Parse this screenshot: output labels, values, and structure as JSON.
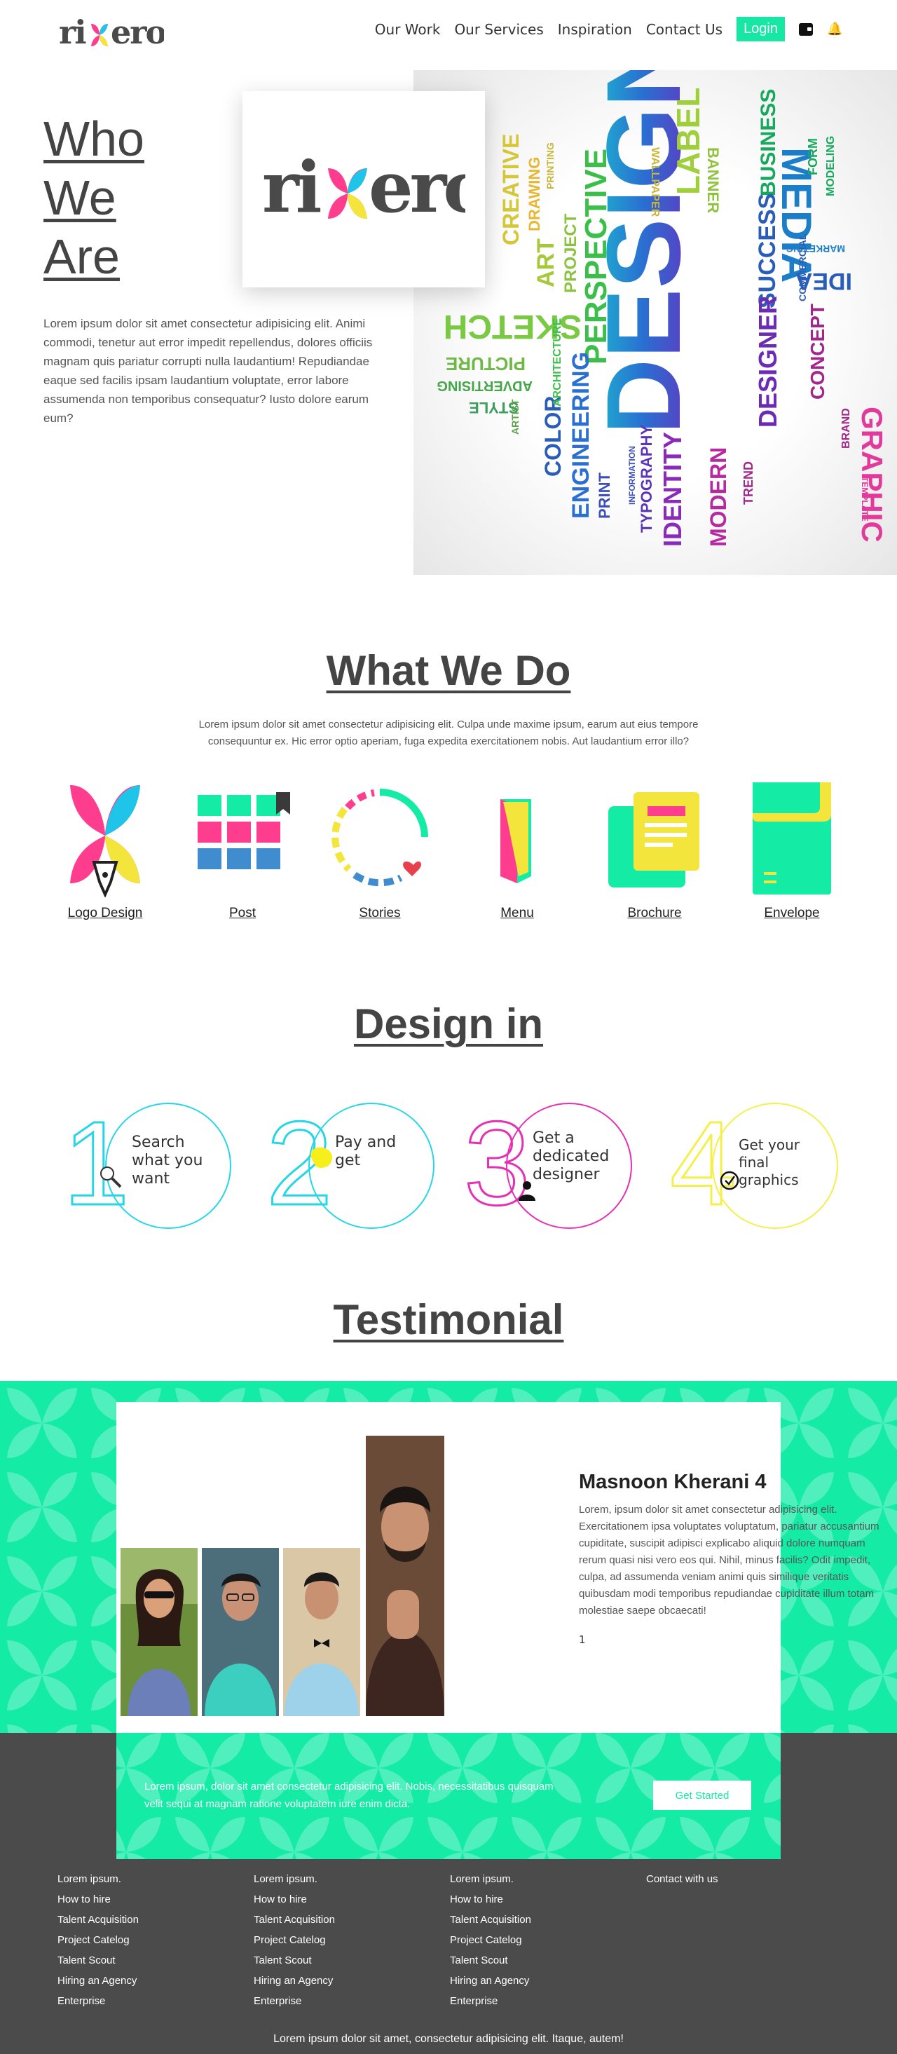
{
  "brand": {
    "logo_text": "rixero",
    "accent": "#16e8a4",
    "dark": "#4b4b4b"
  },
  "nav": {
    "links": [
      "Our Work",
      "Our Services",
      "Inspiration",
      "Contact Us"
    ],
    "login_label": "Login",
    "icons": [
      "wallet-icon",
      "bell-icon"
    ]
  },
  "hero": {
    "title_lines": [
      "Who",
      "We",
      "Are"
    ],
    "text": "Lorem ipsum dolor sit amet consectetur adipisicing elit. Animi commodi, tenetur aut error impedit repellendus, dolores officiis magnam quis pariatur corrupti nulla laudantium! Repudiandae eaque sed facilis ipsam laudantium voluptate, error labore assumenda non temporibus consequatur? Iusto dolore earum eum?",
    "word_cloud": [
      "DESIGN",
      "PERSPECTIVE",
      "SKETCH",
      "LABEL",
      "MEDIA",
      "BUSINESS",
      "SUCCESS",
      "DESIGNER",
      "GRAPHIC",
      "IDEA",
      "MARKETING",
      "CONCEPT",
      "ENGINEERING",
      "COLOR",
      "ARCHITECTURE",
      "PROJECT",
      "ART",
      "CREATIVE",
      "DRAWING",
      "PICTURE",
      "ADVERTISING",
      "STYLE",
      "IDENTITY",
      "MODERN",
      "TYPOGRAPHY",
      "PRINT",
      "WALLPAPER",
      "BANNER",
      "TEMPLATE",
      "BRAND",
      "TREND",
      "FORM",
      "MODELING",
      "COMMERCIAL",
      "ARTIST",
      "INFORMATION",
      "PRINTING"
    ]
  },
  "what_we_do": {
    "title": "What We Do",
    "subtitle": "Lorem ipsum dolor sit amet consectetur adipisicing elit. Culpa unde maxime ipsum, earum aut eius tempore consequuntur ex. Hic error optio aperiam, fuga expedita exercitationem nobis. Aut laudantium error illo?",
    "services": [
      {
        "label": "Logo Design",
        "icon": "pen-nib-icon"
      },
      {
        "label": "Post",
        "icon": "grid-post-icon"
      },
      {
        "label": "Stories",
        "icon": "stories-ring-icon"
      },
      {
        "label": "Menu",
        "icon": "menu-fold-icon"
      },
      {
        "label": "Brochure",
        "icon": "brochure-icon"
      },
      {
        "label": "Envelope",
        "icon": "envelope-icon"
      }
    ]
  },
  "design_in": {
    "title": "Design in",
    "steps": [
      {
        "number": "1",
        "text": "Search what you want",
        "color": "#27d6e6",
        "icon": "magnifier-icon"
      },
      {
        "number": "2",
        "text": "Pay and get",
        "color": "#27d6e6",
        "icon": "coin-blob-icon"
      },
      {
        "number": "3",
        "text": "Get a dedicated designer",
        "color": "#e630b4",
        "icon": "person-icon"
      },
      {
        "number": "4",
        "text": "Get your final graphics",
        "color": "#f4ef4a",
        "icon": "check-circle-icon"
      }
    ]
  },
  "testimonial": {
    "title": "Testimonial",
    "name": "Masnoon Kherani 4",
    "text": "Lorem, ipsum dolor sit amet consectetur adipisicing elit. Exercitationem ipsa voluptates voluptatum, pariatur accusantium cupiditate, suscipit adipisci explicabo aliquid dolore numquam rerum quasi nisi vero eos qui. Nihil, minus facilis? Odit impedit, culpa, ad assumenda veniam animi quis similique veritatis quibusdam modi temporibus repudiandae cupiditate illum totam molestiae saepe obcaecati!",
    "index": "1"
  },
  "cta": {
    "text": "Lorem ipsum, dolor sit amet consectetur adipisicing elit. Nobis, necessitatibus quisquam velit sequi at magnam ratione voluptatem iure enim dicta.",
    "button_label": "Get Started"
  },
  "footer": {
    "columns": [
      [
        "Lorem ipsum.",
        "How to hire",
        "Talent Acquisition",
        "Project Catelog",
        "Talent Scout",
        "Hiring an Agency",
        "Enterprise"
      ],
      [
        "Lorem ipsum.",
        "How to hire",
        "Talent Acquisition",
        "Project Catelog",
        "Talent Scout",
        "Hiring an Agency",
        "Enterprise"
      ],
      [
        "Lorem ipsum.",
        "How to hire",
        "Talent Acquisition",
        "Project Catelog",
        "Talent Scout",
        "Hiring an Agency",
        "Enterprise"
      ],
      [
        "Contact with us"
      ]
    ],
    "copyright": "Lorem ipsum dolor sit amet, consectetur adipisicing elit. Itaque, autem!"
  }
}
